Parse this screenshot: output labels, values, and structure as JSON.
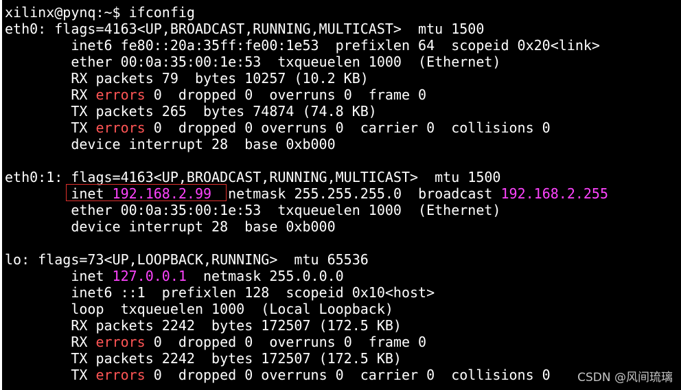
{
  "terminal": {
    "background": "#000000",
    "foreground": "#ffffff",
    "colors": {
      "error": "#ff5555",
      "ip": "#ff44ff"
    },
    "lines": [
      [
        [
          "xilinx@pynq:~$ ifconfig",
          "n"
        ]
      ],
      [
        [
          "eth0: flags=4163<UP,BROADCAST,RUNNING,MULTICAST>  mtu 1500",
          "n"
        ]
      ],
      [
        [
          "        inet6 fe80::20a:35ff:fe00:1e53  prefixlen 64  scopeid 0x20<link>",
          "n"
        ]
      ],
      [
        [
          "        ether 00:0a:35:00:1e:53  txqueuelen 1000  (Ethernet)",
          "n"
        ]
      ],
      [
        [
          "        RX packets 79  bytes 10257 (10.2 KB)",
          "n"
        ]
      ],
      [
        [
          "        RX ",
          "n"
        ],
        [
          "errors",
          "e"
        ],
        [
          " 0  dropped 0  overruns 0  frame 0",
          "n"
        ]
      ],
      [
        [
          "        TX packets 265  bytes 74874 (74.8 KB)",
          "n"
        ]
      ],
      [
        [
          "        TX ",
          "n"
        ],
        [
          "errors",
          "e"
        ],
        [
          " 0  dropped 0 overruns 0  carrier 0  collisions 0",
          "n"
        ]
      ],
      [
        [
          "        device interrupt 28  base 0xb000",
          "n"
        ]
      ],
      [
        [
          "",
          "n"
        ]
      ],
      [
        [
          "eth0:1: flags=4163<UP,BROADCAST,RUNNING,MULTICAST>  mtu 1500",
          "n"
        ]
      ],
      [
        [
          "        inet ",
          "n"
        ],
        [
          "192.168.2.99",
          "i"
        ],
        [
          "  netmask 255.255.255.0  broadcast ",
          "n"
        ],
        [
          "192.168.2.255",
          "i"
        ]
      ],
      [
        [
          "        ether 00:0a:35:00:1e:53  txqueuelen 1000  (Ethernet)",
          "n"
        ]
      ],
      [
        [
          "        device interrupt 28  base 0xb000",
          "n"
        ]
      ],
      [
        [
          "",
          "n"
        ]
      ],
      [
        [
          "lo: flags=73<UP,LOOPBACK,RUNNING>  mtu 65536",
          "n"
        ]
      ],
      [
        [
          "        inet ",
          "n"
        ],
        [
          "127.0.0.1",
          "i"
        ],
        [
          "  netmask 255.0.0.0",
          "n"
        ]
      ],
      [
        [
          "        inet6 ::1  prefixlen 128  scopeid 0x10<host>",
          "n"
        ]
      ],
      [
        [
          "        loop  txqueuelen 1000  (Local Loopback)",
          "n"
        ]
      ],
      [
        [
          "        RX packets 2242  bytes 172507 (172.5 KB)",
          "n"
        ]
      ],
      [
        [
          "        RX ",
          "n"
        ],
        [
          "errors",
          "e"
        ],
        [
          " 0  dropped 0  overruns 0  frame 0",
          "n"
        ]
      ],
      [
        [
          "        TX packets 2242  bytes 172507 (172.5 KB)",
          "n"
        ]
      ],
      [
        [
          "        TX ",
          "n"
        ],
        [
          "errors",
          "e"
        ],
        [
          " 0  dropped 0 overruns 0  carrier 0  collisions 0",
          "n"
        ]
      ]
    ]
  },
  "watermark": "CSDN @风间琉璃"
}
